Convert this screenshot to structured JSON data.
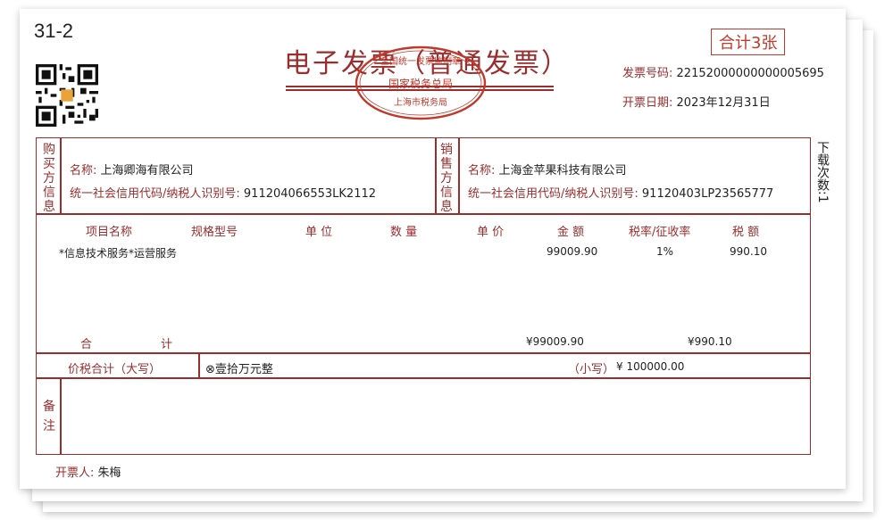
{
  "page_label": "31-2",
  "badge": "合计3张",
  "title": "电子发票（普通发票）",
  "seal": {
    "top_text": "全国统一发票监制章",
    "middle_text": "国家税务总局",
    "bottom_text": "上海市税务局"
  },
  "invoice_number": {
    "label": "发票号码:",
    "value": "22152000000000005695"
  },
  "issue_date": {
    "label": "开票日期:",
    "value": "2023年12月31日"
  },
  "download_count": "下载次数:1",
  "buyer": {
    "section_label": [
      "购",
      "买",
      "方",
      "信",
      "息"
    ],
    "name_label": "名称:",
    "name": "上海卿海有限公司",
    "tax_id_label": "统一社会信用代码/纳税人识别号:",
    "tax_id": "911204066553LK2112"
  },
  "seller": {
    "section_label": [
      "销",
      "售",
      "方",
      "信",
      "息"
    ],
    "name_label": "名称:",
    "name": "上海金苹果科技有限公司",
    "tax_id_label": "统一社会信用代码/纳税人识别号:",
    "tax_id": "91120403LP23565777"
  },
  "columns": {
    "item": "项目名称",
    "spec": "规格型号",
    "unit": "单 位",
    "qty": "数 量",
    "price": "单 价",
    "amount": "金 额",
    "rate": "税率/征收率",
    "tax": "税 额"
  },
  "items": [
    {
      "item": "*信息技术服务*运营服务",
      "spec": "",
      "unit": "",
      "qty": "",
      "price": "",
      "amount": "99009.90",
      "rate": "1%",
      "tax": "990.10"
    }
  ],
  "totals": {
    "label_1": "合",
    "label_2": "计",
    "amount": "¥99009.90",
    "tax": "¥990.10"
  },
  "grand_total": {
    "label": "价税合计（大写）",
    "upper": "⊗壹拾万元整",
    "small_label": "（小写）",
    "small": "¥ 100000.00"
  },
  "remarks": {
    "label": [
      "备",
      "注"
    ],
    "value": ""
  },
  "issuer": {
    "label": "开票人:",
    "name": "朱梅"
  },
  "colors": {
    "accent": "#9b2d2d",
    "badge": "#c0392b"
  }
}
